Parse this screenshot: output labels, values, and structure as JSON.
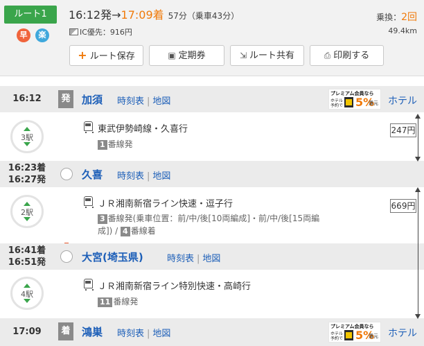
{
  "route": {
    "badge": "ルート1",
    "flag_fast": "早",
    "flag_easy": "楽",
    "depart": "16:12発",
    "arrow": "→",
    "arrive": "17:09着",
    "duration": "57分（乗車43分）",
    "fare_label": "IC優先：916円",
    "transfers_label": "乗換：",
    "transfers_value": "2回",
    "distance": "49.4km",
    "accent_color": "#3aa54b",
    "arrival_color": "#f07a0a"
  },
  "actions": {
    "save": "ルート保存",
    "pass": "定期券",
    "share": "ルート共有",
    "print": "印刷する"
  },
  "stations": [
    {
      "time": "16:12",
      "tag": "発",
      "name": "加須",
      "timetable": "時刻表",
      "map": "地図",
      "hotel": "ホテル"
    },
    {
      "time_arr": "16:23着",
      "time_dep": "16:27発",
      "name": "久喜",
      "timetable": "時刻表",
      "map": "地図"
    },
    {
      "time_arr": "16:41着",
      "time_dep": "16:51発",
      "name": "大宮(埼玉県)",
      "timetable": "時刻表",
      "map": "地図"
    },
    {
      "time": "17:09",
      "tag": "着",
      "name": "鴻巣",
      "timetable": "時刻表",
      "map": "地図",
      "hotel": "ホテル"
    }
  ],
  "promo": {
    "line1": "プレミアム会員なら",
    "line2a": "ホテル",
    "line2b": "予約で",
    "big": "5%",
    "unit": "還元"
  },
  "segments": [
    {
      "stops": "3駅",
      "line": "東武伊勢崎線・久喜行",
      "platform_num": "1",
      "platform_text": "番線発",
      "color": "#f08300"
    },
    {
      "stops": "2駅",
      "line": "ＪＲ湘南新宿ライン快速・逗子行",
      "platform_num": "3",
      "platform_text": "番線発(乗車位置：前/中/後[10両編成]・前/中/後[15両編成]) / ",
      "platform_num2": "4",
      "platform_text2": "番線着",
      "color": "#e8552a"
    },
    {
      "stops": "4駅",
      "line": "ＪＲ湘南新宿ライン特別快速・高崎行",
      "platform_num": "11",
      "platform_text": "番線発",
      "color": "#e8552a"
    }
  ],
  "fares": [
    "247円",
    "669円"
  ]
}
